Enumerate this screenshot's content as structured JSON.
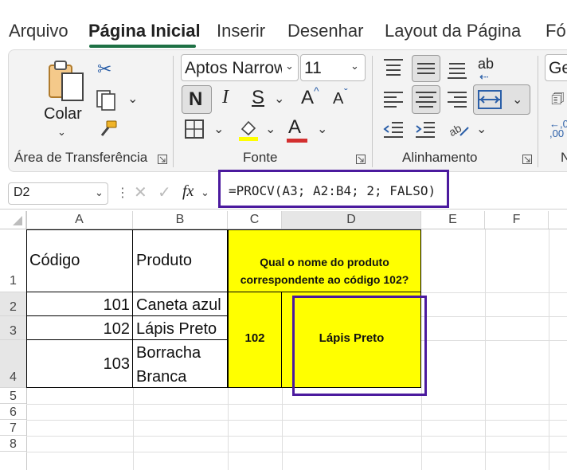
{
  "tabs": [
    {
      "label": "Arquivo",
      "active": false
    },
    {
      "label": "Página Inicial",
      "active": true
    },
    {
      "label": "Inserir",
      "active": false
    },
    {
      "label": "Desenhar",
      "active": false
    },
    {
      "label": "Layout da Página",
      "active": false
    },
    {
      "label": "Fó",
      "active": false
    }
  ],
  "ribbon": {
    "clipboard": {
      "paste_label": "Colar",
      "group_label": "Área de Transferência"
    },
    "font": {
      "font_name": "Aptos Narrow",
      "font_size": "11",
      "bold": "N",
      "italic": "I",
      "underline": "S",
      "grow": "A",
      "shrink": "A",
      "font_color": "A",
      "group_label": "Fonte"
    },
    "alignment": {
      "group_label": "Alinhamento",
      "wrap_glyph": "ab"
    },
    "number": {
      "format_partial": "Ge",
      "group_partial": "N"
    }
  },
  "formula_bar": {
    "name_box": "D2",
    "fx": "fx",
    "formula": "=PROCV(A3; A2:B4; 2; FALSO)"
  },
  "sheet": {
    "columns": [
      "A",
      "B",
      "C",
      "D",
      "E",
      "F"
    ],
    "rows": [
      "1",
      "2",
      "3",
      "4",
      "5",
      "6",
      "7",
      "8"
    ],
    "header_codigo": "Código",
    "header_produto": "Produto",
    "question": "Qual o nome do produto correspondente ao código 102?",
    "data": [
      {
        "codigo": "101",
        "produto": "Caneta azul"
      },
      {
        "codigo": "102",
        "produto": "Lápis Preto"
      },
      {
        "codigo": "103",
        "produto_line1": "Borracha",
        "produto_line2": "Branca"
      }
    ],
    "lookup_code": "102",
    "result": "Lápis Preto"
  },
  "colors": {
    "accent_tab": "#1e7145",
    "highlight_fill": "#ffff00",
    "annotation_border": "#4b1a9e"
  }
}
